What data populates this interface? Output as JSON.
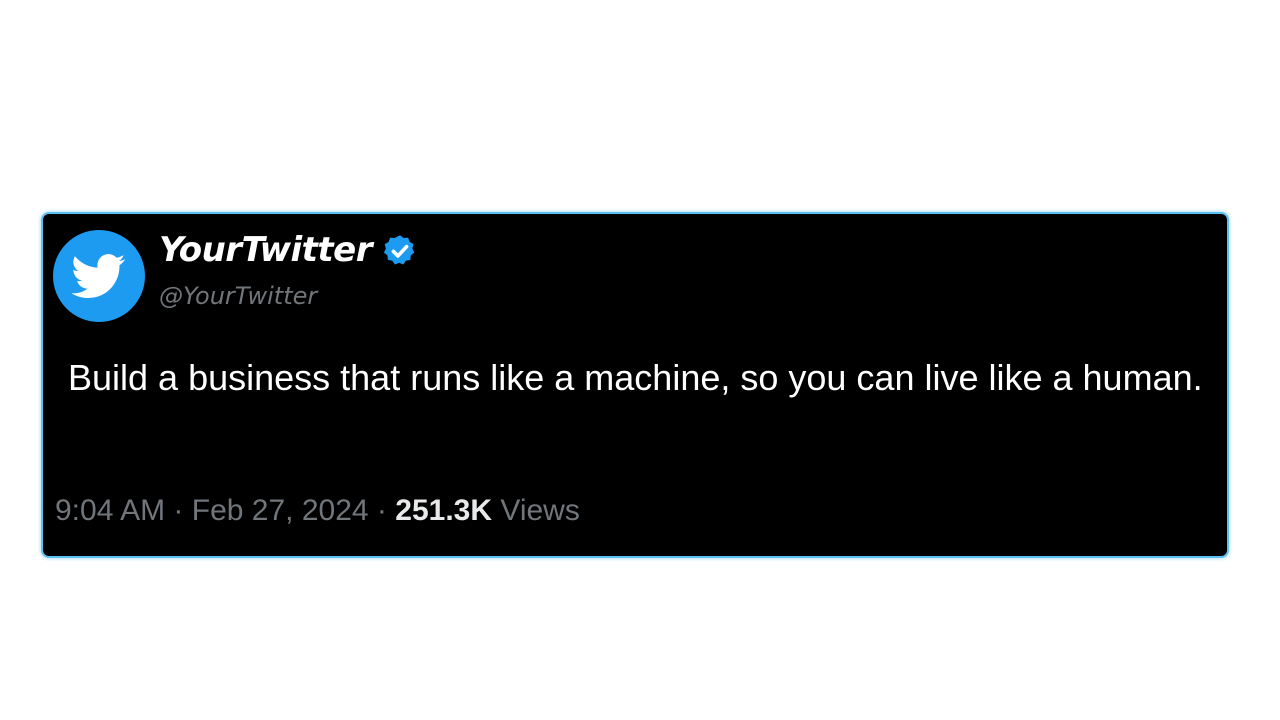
{
  "tweet": {
    "display_name": "YourTwitter",
    "handle": "@YourTwitter",
    "verified": true,
    "text": "Build a business that runs like a machine, so you can live like a human.",
    "time": "9:04 AM",
    "separator": "·",
    "date": "Feb 27, 2024",
    "views_count": "251.3K",
    "views_label": "Views"
  },
  "icons": {
    "avatar": "twitter-bird-icon",
    "badge": "verified-badge-icon"
  },
  "colors": {
    "card_background": "#000000",
    "card_border": "#5cc0f2",
    "avatar_background": "#1d9bf0",
    "verified_badge": "#1d9bf0",
    "secondary_text": "#71767b",
    "primary_text": "#ffffff"
  }
}
